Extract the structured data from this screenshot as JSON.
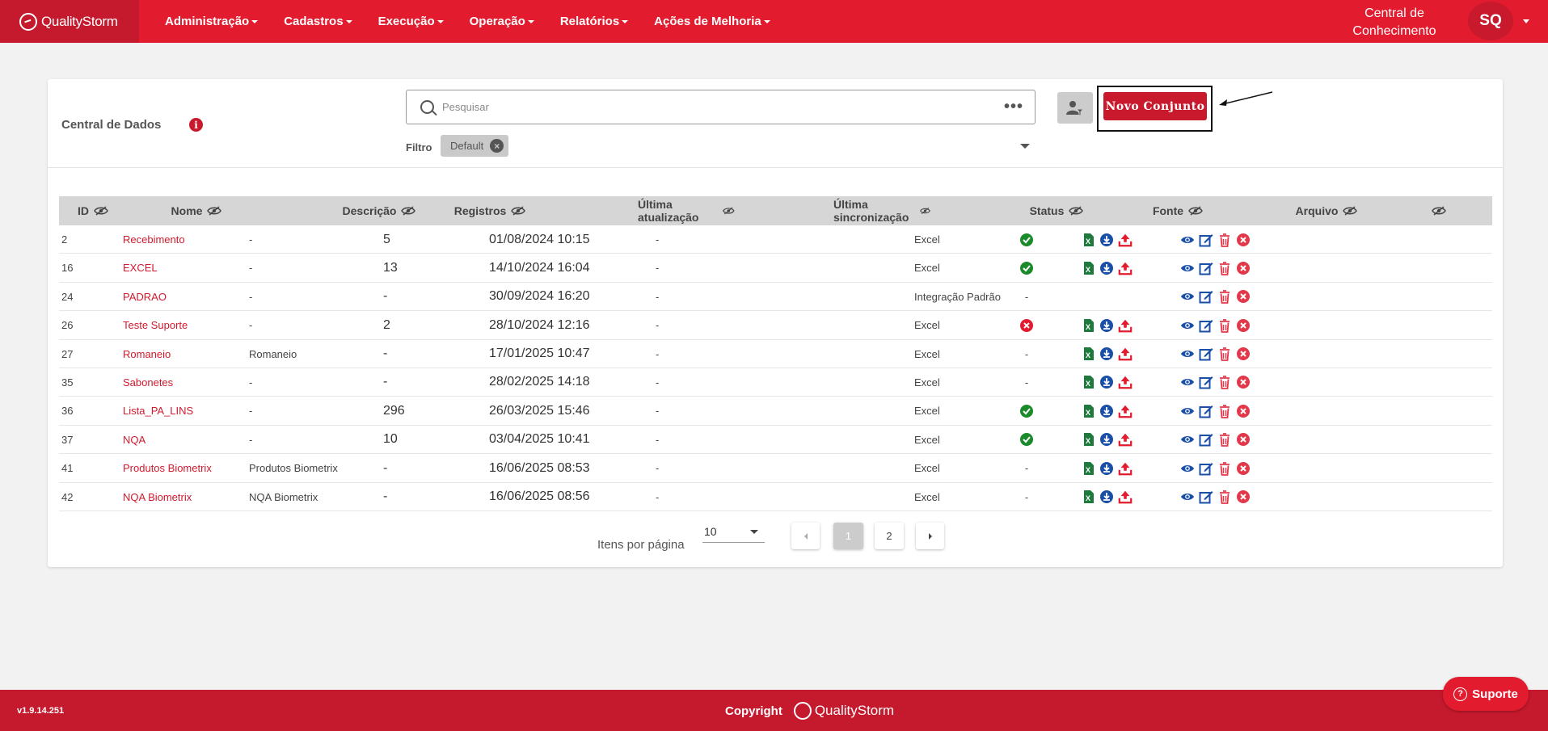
{
  "header": {
    "brand": "QualityStorm",
    "nav": [
      "Administração",
      "Cadastros",
      "Execução",
      "Operação",
      "Relatórios",
      "Ações de Melhoria"
    ],
    "knowledge_line1": "Central de",
    "knowledge_line2": "Conhecimento",
    "avatar": "SQ",
    "color": "#e31b2f"
  },
  "card": {
    "title": "Central de Dados",
    "search_placeholder": "Pesquisar",
    "filter_label": "Filtro",
    "filter_chip": "Default",
    "new_button": "Novo Conjunto"
  },
  "table": {
    "columns": [
      "ID",
      "Nome",
      "Descrição",
      "Registros",
      "Última atualização",
      "Última sincronização",
      "Status",
      "Fonte",
      "Arquivo"
    ],
    "rows": [
      {
        "id": "2",
        "nome": "Recebimento",
        "descricao": "-",
        "registros": "5",
        "atualizacao": "01/08/2024 10:15",
        "sincronizacao": "-",
        "status": "ok",
        "fonte": "Excel",
        "arquivo": true
      },
      {
        "id": "16",
        "nome": "EXCEL",
        "descricao": "-",
        "registros": "13",
        "atualizacao": "14/10/2024 16:04",
        "sincronizacao": "-",
        "status": "ok",
        "fonte": "Excel",
        "arquivo": true
      },
      {
        "id": "24",
        "nome": "PADRAO",
        "descricao": "-",
        "registros": "-",
        "atualizacao": "30/09/2024 16:20",
        "sincronizacao": "-",
        "status": "-",
        "fonte": "Integração Padrão",
        "arquivo": false
      },
      {
        "id": "26",
        "nome": "Teste Suporte",
        "descricao": "-",
        "registros": "2",
        "atualizacao": "28/10/2024 12:16",
        "sincronizacao": "-",
        "status": "error",
        "fonte": "Excel",
        "arquivo": true
      },
      {
        "id": "27",
        "nome": "Romaneio",
        "descricao": "Romaneio",
        "registros": "-",
        "atualizacao": "17/01/2025 10:47",
        "sincronizacao": "-",
        "status": "-",
        "fonte": "Excel",
        "arquivo": true
      },
      {
        "id": "35",
        "nome": "Sabonetes",
        "descricao": "-",
        "registros": "-",
        "atualizacao": "28/02/2025 14:18",
        "sincronizacao": "-",
        "status": "-",
        "fonte": "Excel",
        "arquivo": true
      },
      {
        "id": "36",
        "nome": "Lista_PA_LINS",
        "descricao": "-",
        "registros": "296",
        "atualizacao": "26/03/2025 15:46",
        "sincronizacao": "-",
        "status": "ok",
        "fonte": "Excel",
        "arquivo": true
      },
      {
        "id": "37",
        "nome": "NQA",
        "descricao": "-",
        "registros": "10",
        "atualizacao": "03/04/2025 10:41",
        "sincronizacao": "-",
        "status": "ok",
        "fonte": "Excel",
        "arquivo": true
      },
      {
        "id": "41",
        "nome": "Produtos Biometrix",
        "descricao": "Produtos Biometrix",
        "registros": "-",
        "atualizacao": "16/06/2025 08:53",
        "sincronizacao": "-",
        "status": "-",
        "fonte": "Excel",
        "arquivo": true
      },
      {
        "id": "42",
        "nome": "NQA Biometrix",
        "descricao": "NQA Biometrix",
        "registros": "-",
        "atualizacao": "16/06/2025 08:56",
        "sincronizacao": "-",
        "status": "-",
        "fonte": "Excel",
        "arquivo": true
      }
    ]
  },
  "pagination": {
    "items_label": "Itens por página",
    "per_page": "10",
    "pages": [
      "1",
      "2"
    ],
    "current_page": "1"
  },
  "footer": {
    "version": "v1.9.14.251",
    "copyright": "Copyright",
    "brand": "QualityStorm",
    "support": "Suporte"
  }
}
